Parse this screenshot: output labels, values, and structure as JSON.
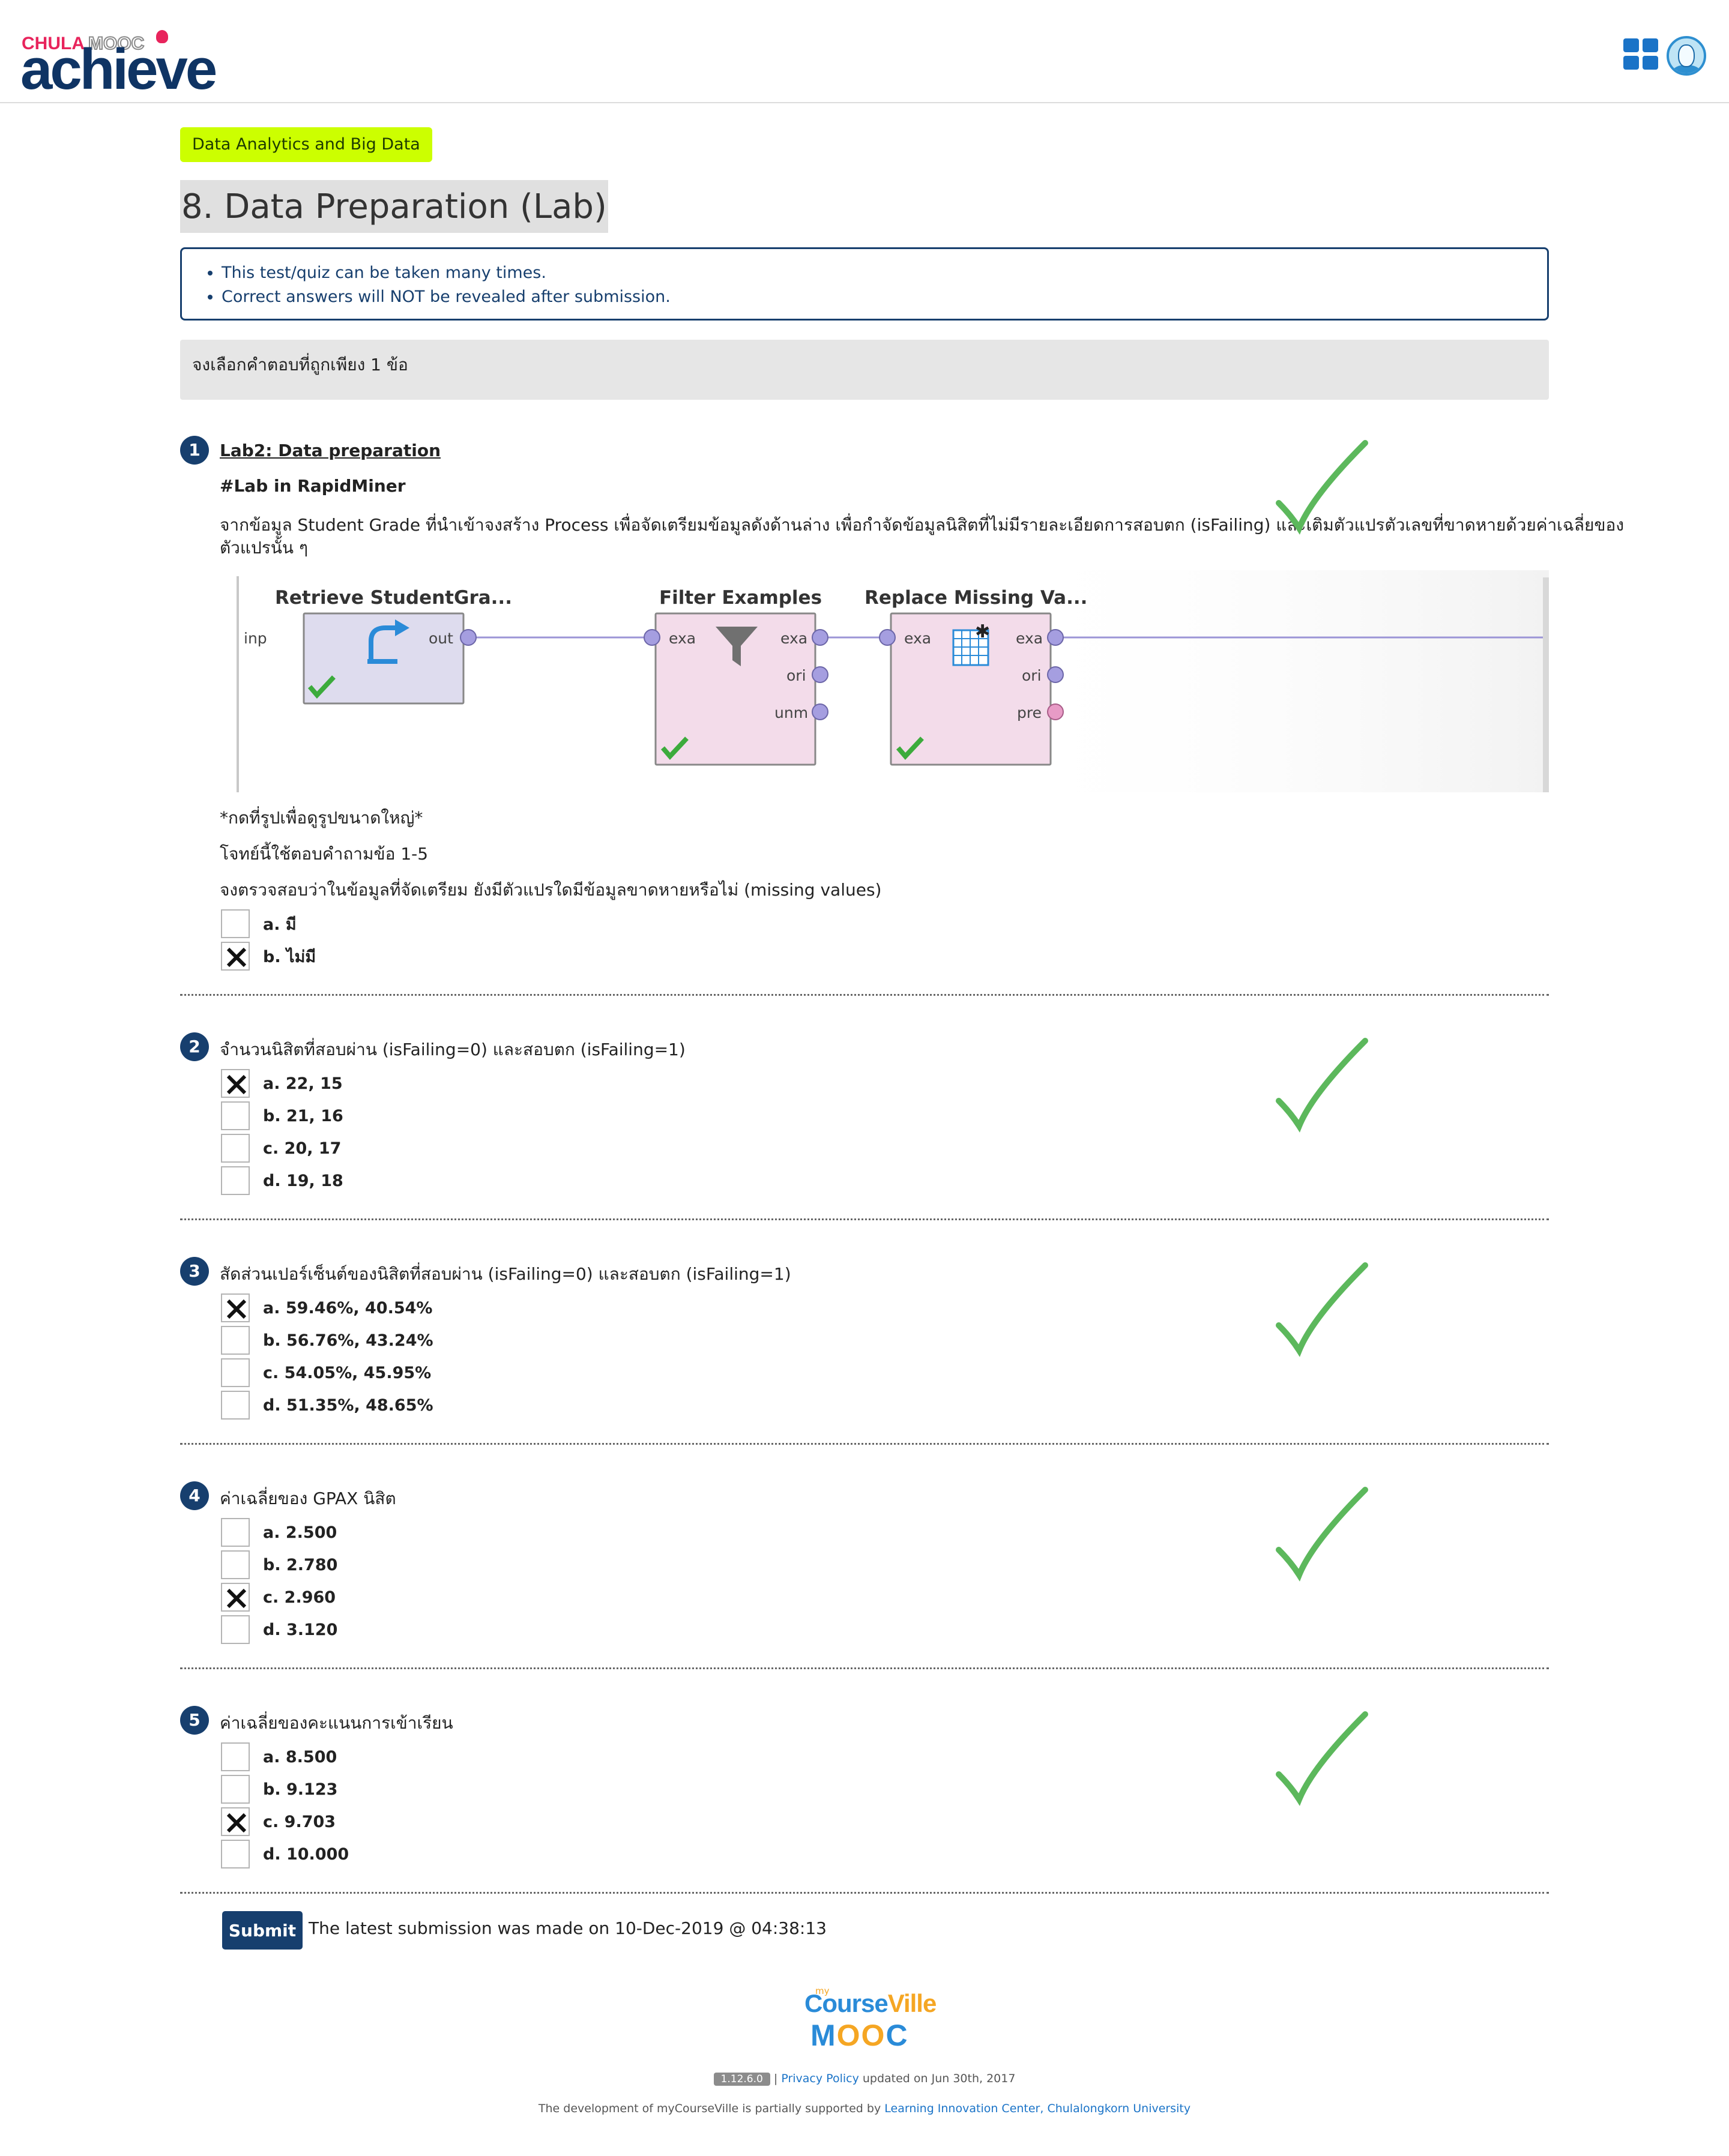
{
  "header": {
    "logo_top_chula": "CHULA",
    "logo_top_mooc": "MOOC",
    "logo_main": "achieve",
    "apps_icon": "apps-grid-icon",
    "avatar_icon": "user-avatar-icon"
  },
  "course_tag": "Data Analytics and Big Data",
  "page_title": "8. Data Preparation (Lab)",
  "notice": [
    "This test/quiz can be taken many times.",
    "Correct answers will NOT be revealed after submission."
  ],
  "instruction": "จงเลือกคำตอบที่ถูกเพียง 1 ข้อ",
  "question1": {
    "number": "1",
    "link": "Lab2: Data preparation",
    "subtitle": "#Lab in RapidMiner",
    "desc_line1": "จากข้อมูล Student Grade ที่นำเข้าจงสร้าง Process เพื่อจัดเตรียมข้อมูลดังด้านล่าง เพื่อกำจัดข้อมูลนิสิตที่ไม่มีรายละเอียดการสอบตก (isFailing) และเติมตัวแปรตัวเลขที่ขาดหายด้วยค่าเฉลี่ยของ",
    "desc_line2": "ตัวแปรนั้น ๆ",
    "diagram": {
      "op1_title": "Retrieve StudentGra...",
      "op1_in": "inp",
      "op1_out": "out",
      "op2_title": "Filter Examples",
      "op2_in": "exa",
      "op2_out1": "exa",
      "op2_out2": "ori",
      "op2_out3": "unm",
      "op3_title": "Replace Missing Va...",
      "op3_in": "exa",
      "op3_out1": "exa",
      "op3_out2": "ori",
      "op3_out3": "pre"
    },
    "note_zoom": "*กดที่รูปเพื่อดูรูปขนาดใหญ่*",
    "note_use": "โจทย์นี้ใช้ตอบคำถามข้อ 1-5",
    "question": "จงตรวจสอบว่าในข้อมูลที่จัดเตรียม ยังมีตัวแปรใดมีข้อมูลขาดหายหรือไม่ (missing values)",
    "options": [
      "a. มี",
      "b. ไม่มี"
    ],
    "selected": 1
  },
  "question2": {
    "number": "2",
    "text": "จำนวนนิสิตที่สอบผ่าน (isFailing=0) และสอบตก (isFailing=1)",
    "options": [
      "a. 22, 15",
      "b. 21, 16",
      "c. 20, 17",
      "d. 19, 18"
    ],
    "selected": 0
  },
  "question3": {
    "number": "3",
    "text": "สัดส่วนเปอร์เซ็นต์ของนิสิตที่สอบผ่าน (isFailing=0) และสอบตก (isFailing=1)",
    "options": [
      "a. 59.46%, 40.54%",
      "b. 56.76%, 43.24%",
      "c. 54.05%, 45.95%",
      "d. 51.35%, 48.65%"
    ],
    "selected": 0
  },
  "question4": {
    "number": "4",
    "text": "ค่าเฉลี่ยของ GPAX นิสิต",
    "options": [
      "a. 2.500",
      "b. 2.780",
      "c. 2.960",
      "d. 3.120"
    ],
    "selected": 2
  },
  "question5": {
    "number": "5",
    "text": "ค่าเฉลี่ยของคะแนนการเข้าเรียน",
    "options": [
      "a. 8.500",
      "b. 9.123",
      "c. 9.703",
      "d. 10.000"
    ],
    "selected": 2
  },
  "correct_mark_icon": "check-mark-icon",
  "submit": {
    "label": "Submit",
    "note": "The latest submission was made on 10-Dec-2019 @ 04:38:13"
  },
  "footer": {
    "logo_my": "my",
    "logo_course": "Course",
    "logo_ville": "Ville",
    "logo_mooc_m": "M",
    "logo_mooc_oo": "OO",
    "logo_mooc_c": "C",
    "version": "1.12.6.0",
    "sep": " | ",
    "privacy": "Privacy Policy",
    "updated": " updated on Jun 30th, 2017",
    "dev_text": "The development of myCourseVille is partially supported by ",
    "dev_link": "Learning Innovation Center, Chulalongkorn University"
  },
  "colors": {
    "navy": "#173f6e",
    "tag_green": "#ccff00",
    "check_green": "#5cb85c",
    "operator_purple": "#e0dcf0",
    "operator_pink": "#f3dcea"
  }
}
